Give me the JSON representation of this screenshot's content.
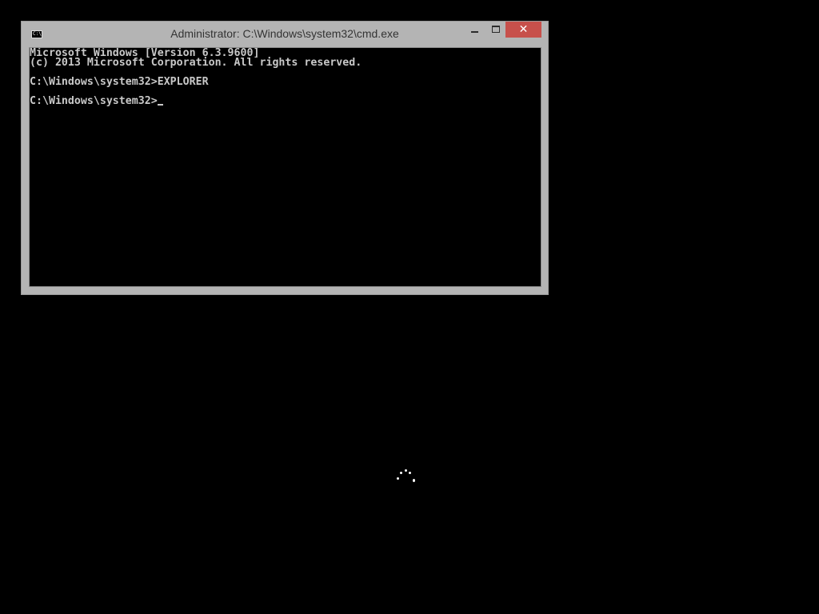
{
  "window": {
    "title": "Administrator: C:\\Windows\\system32\\cmd.exe",
    "icon": "cmd-icon",
    "icon_text": "C:\\.",
    "close_glyph": "✕"
  },
  "console": {
    "lines": [
      "Microsoft Windows [Version 6.3.9600]",
      "(c) 2013 Microsoft Corporation. All rights reserved.",
      "C:\\Windows\\system32>EXPLORER",
      "C:\\Windows\\system32>"
    ]
  },
  "colors": {
    "close_button": "#c7504b",
    "console_background": "#000000",
    "console_text": "#c8c8c8",
    "window_frame": "#b4b4b4"
  },
  "loading_indicator": {
    "icon": "loading-spinner-icon"
  }
}
